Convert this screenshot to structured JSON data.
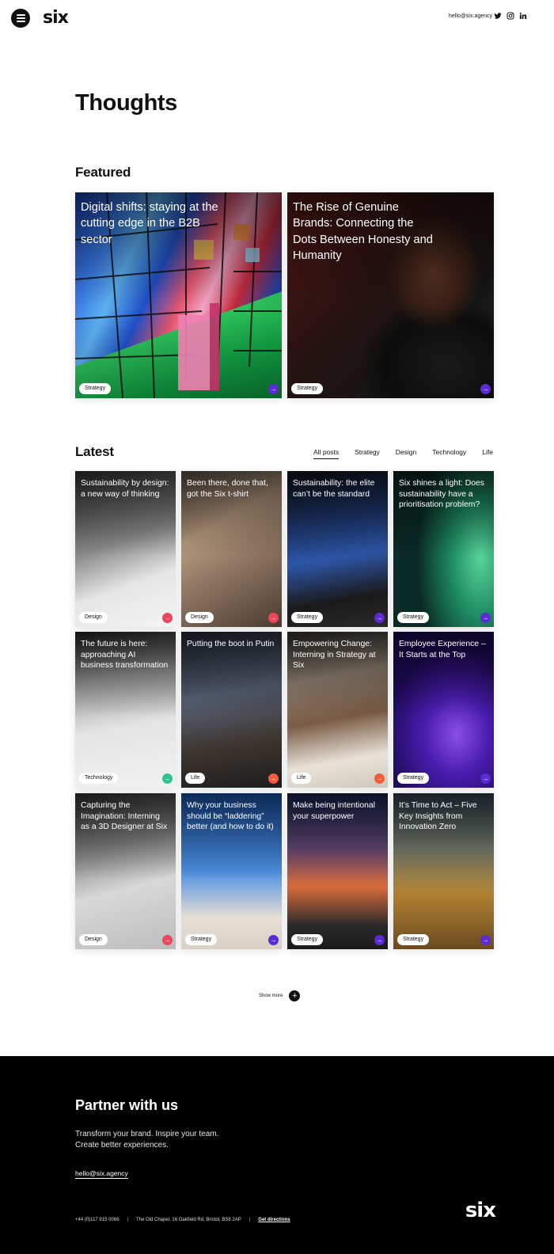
{
  "header": {
    "logo": "six",
    "email": "hello@six.agency",
    "social": [
      "twitter-icon",
      "instagram-icon",
      "linkedin-icon"
    ]
  },
  "page_title": "Thoughts",
  "featured": {
    "title": "Featured",
    "cards": [
      {
        "title": "Digital shifts: staying at the cutting edge in the B2B sector",
        "tag": "Strategy",
        "arrow_color": "#5b2bd6"
      },
      {
        "title": "The Rise of Genuine Brands: Connecting the Dots Between Honesty and Humanity",
        "tag": "Strategy",
        "arrow_color": "#5b2bd6"
      }
    ]
  },
  "latest": {
    "title": "Latest",
    "filters": [
      "All posts",
      "Strategy",
      "Design",
      "Technology",
      "Life"
    ],
    "active_filter": "All posts",
    "cards": [
      {
        "title": "Sustainability by design: a new way of thinking",
        "tag": "Design",
        "arrow_color": "#f0445a"
      },
      {
        "title": "Been there, done that, got the Six t-shirt",
        "tag": "Design",
        "arrow_color": "#f0445a"
      },
      {
        "title": "Sustainability: the elite can’t be the standard",
        "tag": "Strategy",
        "arrow_color": "#5b2bd6"
      },
      {
        "title": "Six shines a light: Does sustainability have a prioritisation problem?",
        "tag": "Strategy",
        "arrow_color": "#5b2bd6"
      },
      {
        "title": "The future is here: approaching AI business transformation",
        "tag": "Technology",
        "arrow_color": "#2fc48d"
      },
      {
        "title": "Putting the boot in Putin",
        "tag": "Life",
        "arrow_color": "#f55a3c"
      },
      {
        "title": "Empowering Change: Interning in Strategy at Six",
        "tag": "Life",
        "arrow_color": "#f55a3c"
      },
      {
        "title": "Employee Experience – It Starts at the Top",
        "tag": "Strategy",
        "arrow_color": "#5b2bd6"
      },
      {
        "title": "Capturing the Imagination: Interning as a 3D Designer at Six",
        "tag": "Design",
        "arrow_color": "#f0445a"
      },
      {
        "title": "Why your business should be “laddering” better (and how to do it)",
        "tag": "Strategy",
        "arrow_color": "#5b2bd6"
      },
      {
        "title": "Make being intentional your superpower",
        "tag": "Strategy",
        "arrow_color": "#5b2bd6"
      },
      {
        "title": "It’s Time to Act – Five Key Insights from Innovation Zero",
        "tag": "Strategy",
        "arrow_color": "#5b2bd6"
      }
    ]
  },
  "show_more": "Show more",
  "footer": {
    "title": "Partner with us",
    "line1": "Transform your brand. Inspire your team.",
    "line2": "Create better experiences.",
    "email": "hello@six.agency",
    "phone": "+44 (0)117 915 0066",
    "address": "The Old Chapel, 16 Oakfield Rd, Bristol, BS8 2AP",
    "directions": "Get directions",
    "logo": "six"
  }
}
